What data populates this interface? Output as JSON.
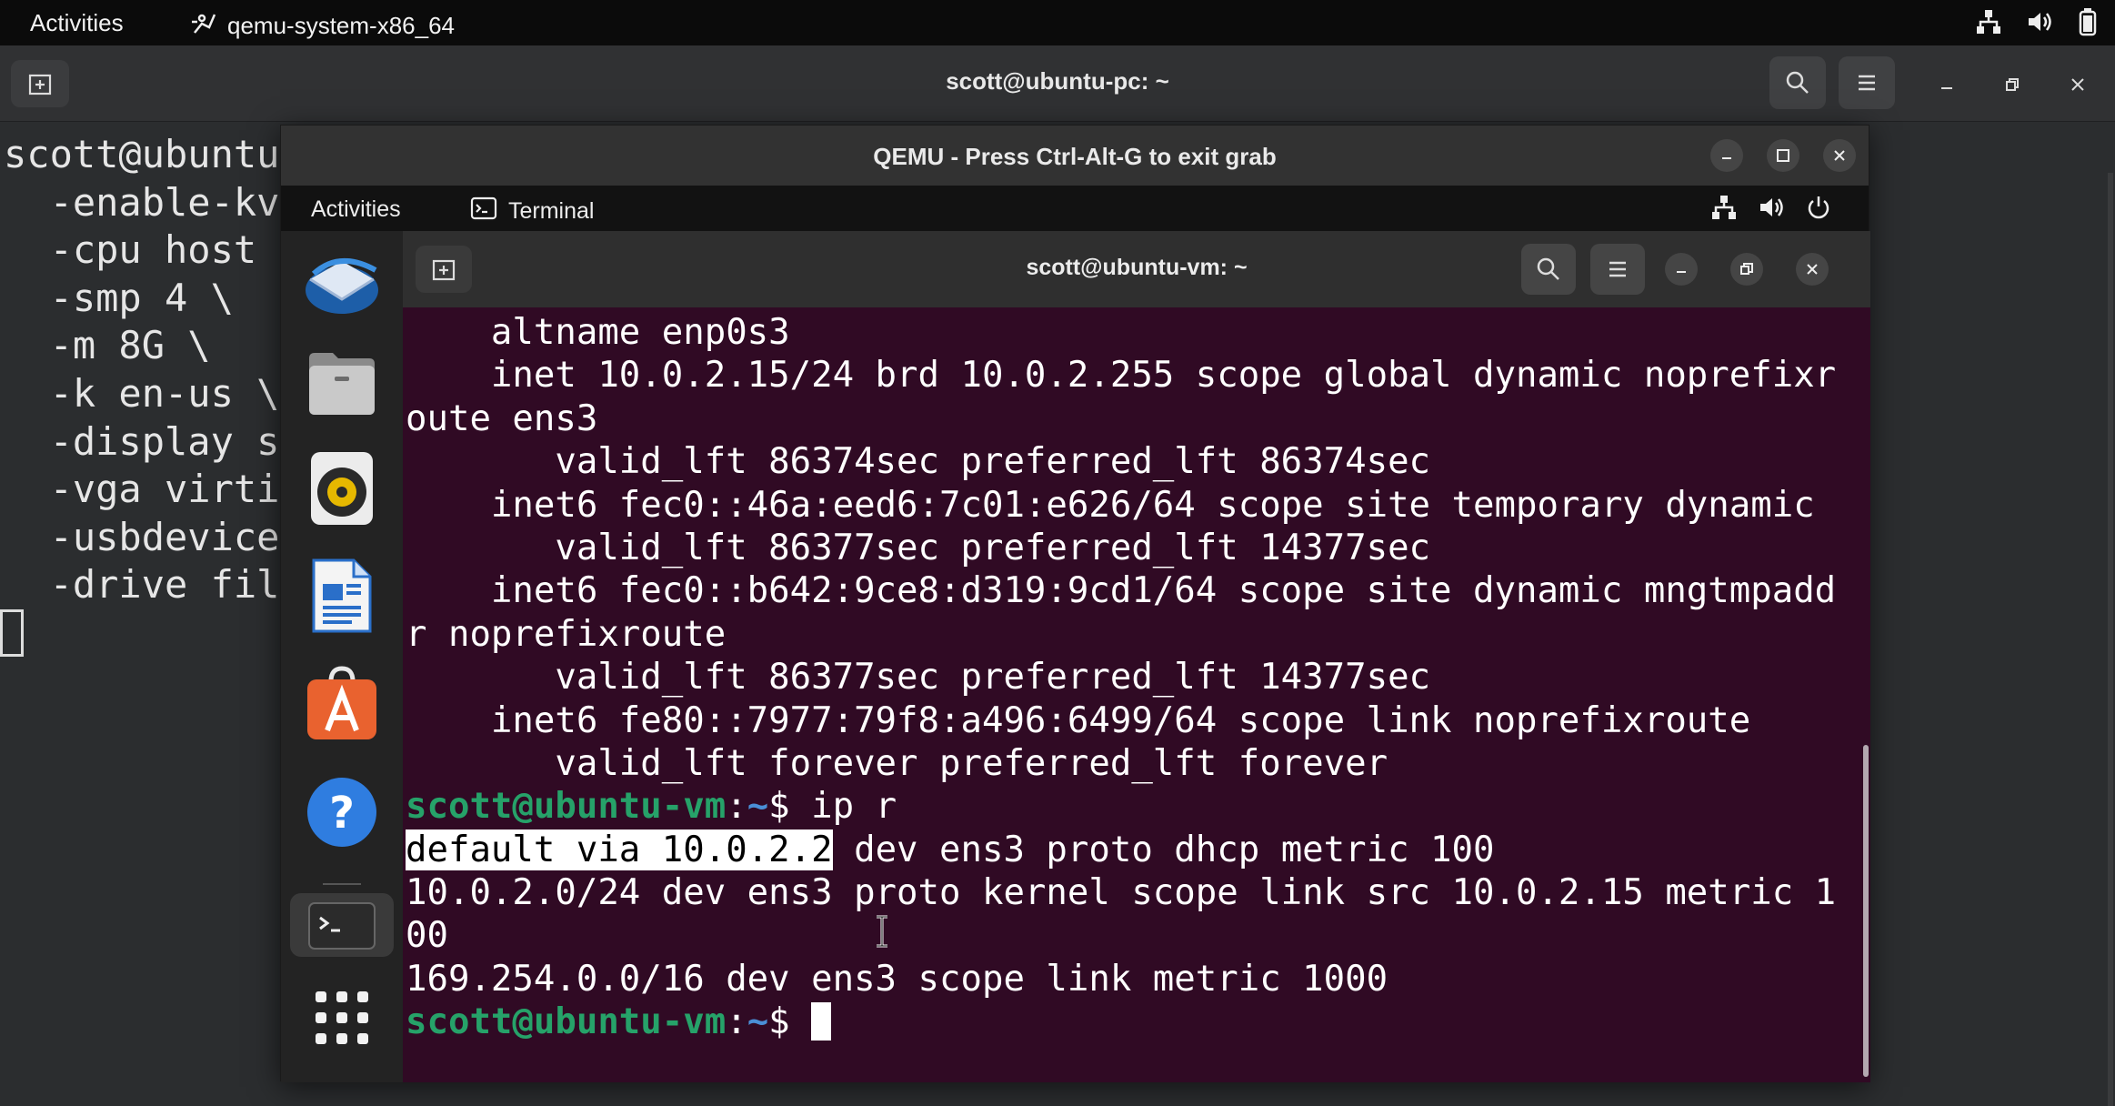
{
  "host_topbar": {
    "activities": "Activities",
    "app_name": "qemu-system-x86_64",
    "icons": [
      "network-icon",
      "volume-icon",
      "battery-icon"
    ]
  },
  "host_terminal": {
    "title": "scott@ubuntu-pc: ~",
    "lines": [
      "scott@ubuntu",
      "  -enable-kv",
      "  -cpu host",
      "  -smp 4 \\",
      "  -m 8G \\",
      "  -k en-us \\",
      "  -display s",
      "  -vga virti",
      "  -usbdevice",
      "  -drive fil"
    ]
  },
  "qemu_window": {
    "title": "QEMU - Press Ctrl-Alt-G to exit grab"
  },
  "guest_topbar": {
    "activities": "Activities",
    "app_name": "Terminal",
    "icons": [
      "network-icon",
      "volume-icon",
      "power-icon"
    ]
  },
  "dock": {
    "items": [
      "thunderbird-icon",
      "files-icon",
      "rhythmbox-icon",
      "writer-icon",
      "app-center-icon",
      "help-icon",
      "terminal-icon",
      "show-apps-icon"
    ]
  },
  "guest_terminal": {
    "title": "scott@ubuntu-vm: ~",
    "output": [
      "    altname enp0s3",
      "    inet 10.0.2.15/24 brd 10.0.2.255 scope global dynamic noprefixr",
      "oute ens3",
      "       valid_lft 86374sec preferred_lft 86374sec",
      "    inet6 fec0::46a:eed6:7c01:e626/64 scope site temporary dynamic",
      "       valid_lft 86377sec preferred_lft 14377sec",
      "    inet6 fec0::b642:9ce8:d319:9cd1/64 scope site dynamic mngtmpadd",
      "r noprefixroute",
      "       valid_lft 86377sec preferred_lft 14377sec",
      "    inet6 fe80::7977:79f8:a496:6499/64 scope link noprefixroute",
      "       valid_lft forever preferred_lft forever"
    ],
    "prompt_user": "scott@ubuntu-vm",
    "prompt_colon": ":",
    "prompt_path": "~",
    "prompt_symbol": "$ ",
    "command": "ip r",
    "route_selected": "default via 10.0.2.2",
    "route_rest": " dev ens3 proto dhcp metric 100",
    "route_output": [
      "10.0.2.0/24 dev ens3 proto kernel scope link src 10.0.2.15 metric 1",
      "00",
      "169.254.0.0/16 dev ens3 scope link metric 1000"
    ]
  }
}
